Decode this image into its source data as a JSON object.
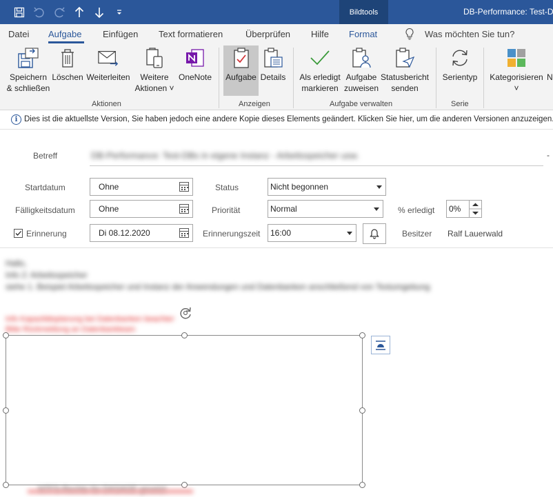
{
  "titlebar": {
    "context_tab": "Bildtools",
    "window_title": "DB-Performance: Test-DB"
  },
  "tabs": [
    {
      "label": "Datei"
    },
    {
      "label": "Aufgabe"
    },
    {
      "label": "Einfügen"
    },
    {
      "label": "Text formatieren"
    },
    {
      "label": "Überprüfen"
    },
    {
      "label": "Hilfe"
    },
    {
      "label": "Format"
    }
  ],
  "tellme": {
    "placeholder": "Was möchten Sie tun?"
  },
  "ribbon": {
    "save_close": {
      "line1": "Speichern",
      "line2": "& schließen"
    },
    "delete": "Löschen",
    "forward": "Weiterleiten",
    "more_actions": {
      "line1": "Weitere",
      "line2": "Aktionen ˅"
    },
    "onenote": "OneNote",
    "task": "Aufgabe",
    "details": "Details",
    "mark_complete": {
      "line1": "Als erledigt",
      "line2": "markieren"
    },
    "assign_task": {
      "line1": "Aufgabe",
      "line2": "zuweisen"
    },
    "send_status": {
      "line1": "Statusbericht",
      "line2": "senden"
    },
    "recurrence": "Serientyp",
    "categorize": "Kategorisieren",
    "categorize_caret": "˅",
    "cut_label": "N",
    "groups": {
      "actions": "Aktionen",
      "show": "Anzeigen",
      "manage": "Aufgabe verwalten",
      "series": "Serie"
    }
  },
  "infobar": {
    "text": "Dies ist die aktuellste Version, Sie haben jedoch eine andere Kopie dieses Elements geändert. Klicken Sie hier, um die anderen Versionen anzuzeigen."
  },
  "form": {
    "subject_label": "Betreff",
    "subject_value": "DB-Performance: Test-DBs in eigene Instanz - Arbeitsspeicher usw.",
    "start_label": "Startdatum",
    "start_value": "Ohne",
    "due_label": "Fälligkeitsdatum",
    "due_value": "Ohne",
    "reminder_label": "Erinnerung",
    "reminder_checked": true,
    "reminder_date": "Di 08.12.2020",
    "status_label": "Status",
    "status_value": "Nicht begonnen",
    "priority_label": "Priorität",
    "priority_value": "Normal",
    "reminder_time_label": "Erinnerungszeit",
    "reminder_time_value": "16:00",
    "percent_label": "% erledigt",
    "percent_value": "0%",
    "owner_label": "Besitzer",
    "owner_value": "Ralf Lauerwald"
  },
  "body": {
    "line1": "Hallo,",
    "line2": "Info 2: Arbeitsspeicher",
    "line3": "siehe 1. Beispiel Arbeitsspeicher und Instanz der Anwendungen und Datenbanken anschließend von Testumgebung",
    "red_line1": "Info Kapazitätsplanung bei Datenbanken beachten",
    "red_line2": "Bitte Rückmeldung an Datenbankteam",
    "bottom_text": "NTFS-Rechte für DASAGE gesetzt"
  }
}
